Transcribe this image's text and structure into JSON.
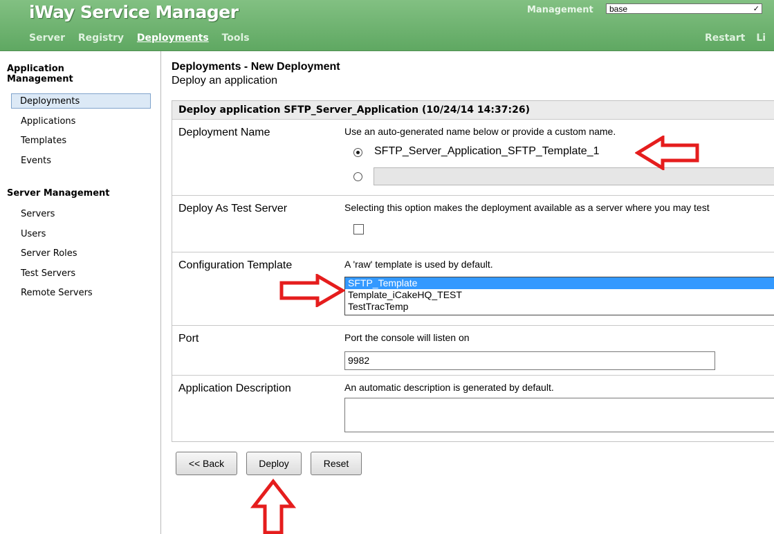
{
  "header": {
    "app_title": "iWay Service Manager",
    "nav": [
      "Server",
      "Registry",
      "Deployments",
      "Tools"
    ],
    "active_nav": "Deployments",
    "right_nav": [
      "Restart",
      "Li"
    ],
    "management_label": "Management",
    "management_value": "base"
  },
  "sidebar": {
    "section1_title": "Application Management",
    "section1_items": [
      "Deployments",
      "Applications",
      "Templates",
      "Events"
    ],
    "selected_item": "Deployments",
    "section2_title": "Server Management",
    "section2_items": [
      "Servers",
      "Users",
      "Server Roles",
      "Test Servers",
      "Remote Servers"
    ]
  },
  "page": {
    "title": "Deployments - New Deployment",
    "subtitle": "Deploy an application"
  },
  "form": {
    "header": "Deploy application SFTP_Server_Application (10/24/14 14:37:26)",
    "deployment_name": {
      "label": "Deployment Name",
      "desc": "Use an auto-generated name below or provide a custom name.",
      "auto_name": "SFTP_Server_Application_SFTP_Template_1",
      "custom_value": ""
    },
    "test_server": {
      "label": "Deploy As Test Server",
      "desc": "Selecting this option makes the deployment available as a server where you may test"
    },
    "config_template": {
      "label": "Configuration Template",
      "desc": "A 'raw' template is used by default.",
      "options": [
        "SFTP_Template",
        "Template_iCakeHQ_TEST",
        "TestTracTemp"
      ],
      "selected": "SFTP_Template"
    },
    "port": {
      "label": "Port",
      "desc": "Port the console will listen on",
      "value": "9982"
    },
    "app_desc": {
      "label": "Application Description",
      "desc": "An automatic description is generated by default.",
      "value": ""
    }
  },
  "buttons": {
    "back": "<< Back",
    "deploy": "Deploy",
    "reset": "Reset"
  },
  "colors": {
    "header_green": "#5fa862",
    "selection_blue": "#3399ff",
    "annotation_red": "#e51d1d"
  }
}
